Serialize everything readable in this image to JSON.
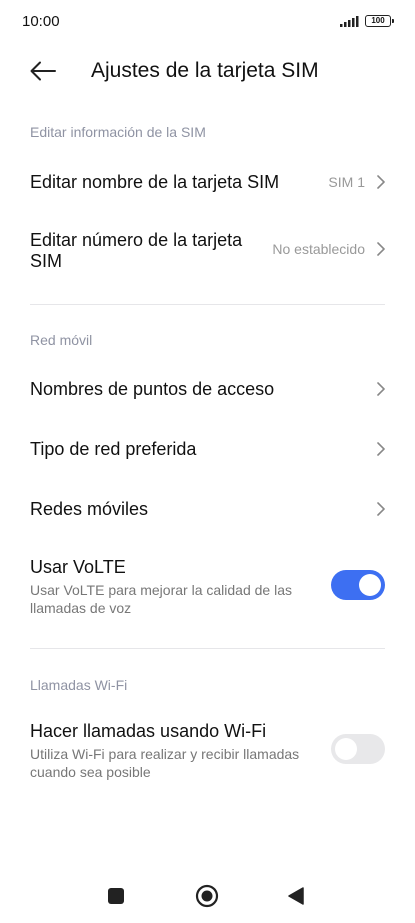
{
  "status_bar": {
    "time": "10:00",
    "battery": "100",
    "icons": [
      "signal-icon",
      "battery-icon"
    ]
  },
  "header": {
    "title": "Ajustes de la tarjeta SIM",
    "back_icon": "arrow-left-icon"
  },
  "sections": {
    "sim_info": {
      "header": "Editar información de la SIM",
      "items": [
        {
          "title": "Editar nombre de la tarjeta SIM",
          "value": "SIM 1"
        },
        {
          "title_line1": "Editar número de la tarjeta",
          "title_line2": "SIM",
          "value": "No establecido"
        }
      ]
    },
    "mobile_network": {
      "header": "Red móvil",
      "items": [
        {
          "title": "Nombres de puntos de acceso"
        },
        {
          "title": "Tipo de red preferida"
        },
        {
          "title": "Redes móviles"
        },
        {
          "title": "Usar VoLTE",
          "subtitle_line1": "Usar VoLTE para mejorar la calidad de las",
          "subtitle_line2": "llamadas de voz",
          "toggle_on": true
        }
      ]
    },
    "wifi_calling": {
      "header": "Llamadas Wi-Fi",
      "items": [
        {
          "title": "Hacer llamadas usando Wi-Fi",
          "subtitle_line1": "Utiliza Wi-Fi para realizar y recibir llamadas",
          "subtitle_line2": "cuando sea posible",
          "toggle_on": false
        }
      ]
    }
  },
  "nav_bar": {
    "icons": [
      "recents-square-icon",
      "home-circle-icon",
      "back-triangle-icon"
    ]
  },
  "colors": {
    "accent": "#3d6ff2",
    "section_header": "#8f93a3",
    "value_text": "#999999",
    "toggle_off": "#e8e8ea"
  }
}
